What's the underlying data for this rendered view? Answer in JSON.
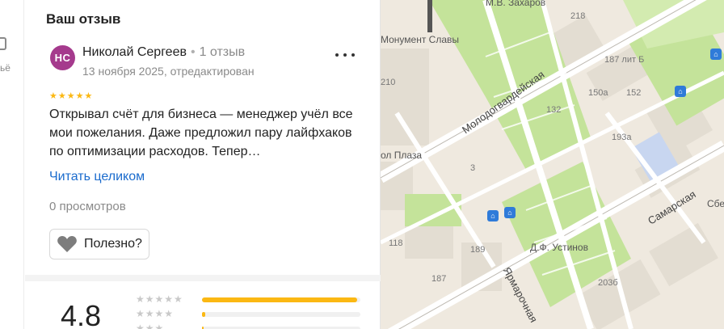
{
  "sidebar": {
    "label": "ьё"
  },
  "panel": {
    "title": "Ваш отзыв",
    "review": {
      "avatar_initials": "НС",
      "author": "Николай Сергеев",
      "separator": "•",
      "review_count": "1 отзыв",
      "date": "13 ноября 2025, отредактирован",
      "stars": "★★★★★",
      "text": "Открывал счёт для бизнеса — менеджер учёл все мои пожелания. Даже предложил пару лайфхаков по оптимизации расходов. Тепер…",
      "read_more": "Читать целиком",
      "views": "0 просмотров",
      "helpful_label": "Полезно?"
    },
    "rating": {
      "value": "4.8",
      "distribution": [
        {
          "stars": "★★★★★",
          "share": 0.98
        },
        {
          "stars": "★★★★",
          "share": 0.02
        },
        {
          "stars": "★★★",
          "share": 0.01
        }
      ]
    }
  },
  "map": {
    "colors": {
      "background": "#efe9df",
      "park": "#c4e39a",
      "building": "#e3ddd2",
      "road": "#ffffff",
      "transit": "#2f7bd9"
    },
    "labels": {
      "monument": "Монумент Славы",
      "street_molodogvardeyskaya": "Молодогвардейская",
      "street_samarskaya": "Самарская",
      "street_yaroslavskaya": "Ярмарочная",
      "park_ustinov": "Д.Ф. Устинов",
      "plaza": "ол Плаза",
      "zakharov": "М.В. Захаров",
      "sber": "Сбер"
    },
    "house_numbers": [
      "218",
      "187 лит Б",
      "210",
      "150а",
      "152",
      "132",
      "193а",
      "3",
      "118",
      "189",
      "187",
      "203б"
    ],
    "bus_icon": "bus-stop-icon"
  }
}
